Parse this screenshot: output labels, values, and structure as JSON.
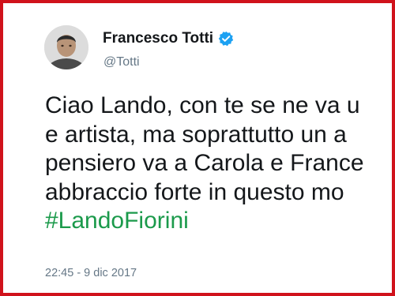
{
  "tweet": {
    "author": {
      "display_name": "Francesco Totti",
      "handle": "@Totti",
      "verified": true,
      "avatar_icon": "profile-photo"
    },
    "lines": [
      "Ciao Lando, con te se ne va u",
      "e artista, ma soprattutto un a",
      "pensiero va a Carola e France",
      "abbraccio forte in questo mo"
    ],
    "hashtag": "#LandoFiorini",
    "timestamp": "22:45 - 9 dic 2017"
  },
  "colors": {
    "frame_border": "#d0121b",
    "verified_badge": "#1da1f2",
    "hashtag": "#1b9a4b",
    "text_primary": "#14171a",
    "text_secondary": "#657786"
  }
}
